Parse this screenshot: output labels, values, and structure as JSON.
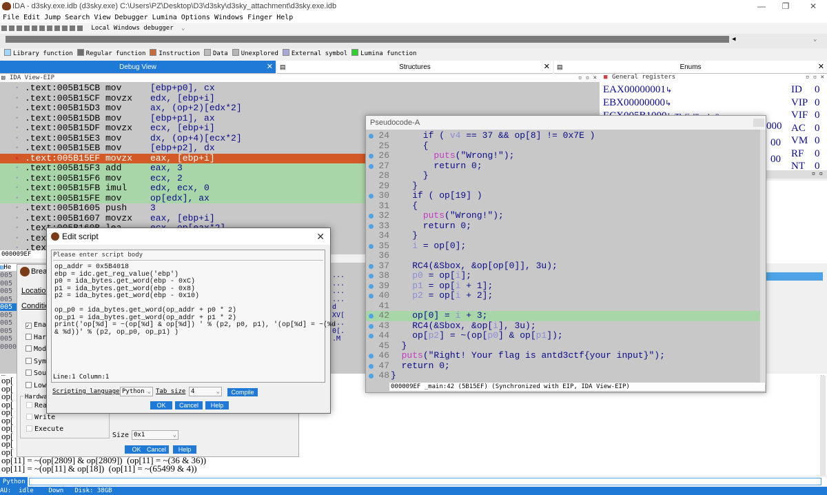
{
  "window": {
    "title": "IDA - d3sky.exe.idb (d3sky.exe) C:\\Users\\PZ\\Desktop\\D3\\d3sky\\d3sky_attachment\\d3sky.exe.idb",
    "minimize": "—",
    "maximize": "❐",
    "close": "✕"
  },
  "menu": [
    "File",
    "Edit",
    "Jump",
    "Search",
    "View",
    "Debugger",
    "Lumina",
    "Options",
    "Windows",
    "Finger",
    "Help"
  ],
  "toolbar": {
    "debugger_label": "Local Windows debugger"
  },
  "legend": [
    {
      "label": "Library function",
      "color": "#a0d8ff"
    },
    {
      "label": "Regular function",
      "color": "#6f6f6f"
    },
    {
      "label": "Instruction",
      "color": "#c56c3e"
    },
    {
      "label": "Data",
      "color": "#bcbcbc"
    },
    {
      "label": "Unexplored",
      "color": "#b5b5b5"
    },
    {
      "label": "External symbol",
      "color": "#a7a7d8"
    },
    {
      "label": "Lumina function",
      "color": "#2fcf2f"
    }
  ],
  "tabs": {
    "debug": "Debug View",
    "structures": "Structures",
    "enums": "Enums"
  },
  "ida_view": {
    "title": "IDA View-EIP",
    "status": "000009EF",
    "lines": [
      {
        "addr": ".text:005B15CB",
        "mn": "mov",
        "op": "[ebp+p0], cx",
        "hl": ""
      },
      {
        "addr": ".text:005B15CF",
        "mn": "movzx",
        "op": "edx, [ebp+i]",
        "hl": ""
      },
      {
        "addr": ".text:005B15D3",
        "mn": "mov",
        "op": "ax, (op+2)[edx*2]",
        "hl": ""
      },
      {
        "addr": ".text:005B15DB",
        "mn": "mov",
        "op": "[ebp+p1], ax",
        "hl": ""
      },
      {
        "addr": ".text:005B15DF",
        "mn": "movzx",
        "op": "ecx, [ebp+i]",
        "hl": ""
      },
      {
        "addr": ".text:005B15E3",
        "mn": "mov",
        "op": "dx, (op+4)[ecx*2]",
        "hl": ""
      },
      {
        "addr": ".text:005B15EB",
        "mn": "mov",
        "op": "[ebp+p2], dx",
        "hl": ""
      },
      {
        "addr": ".text:005B15EF",
        "mn": "movzx",
        "op": "eax, [ebp+i]",
        "hl": "bp"
      },
      {
        "addr": ".text:005B15F3",
        "mn": "add",
        "op": "eax, 3",
        "hl": "g"
      },
      {
        "addr": ".text:005B15F6",
        "mn": "mov",
        "op": "ecx, 2",
        "hl": "g"
      },
      {
        "addr": ".text:005B15FB",
        "mn": "imul",
        "op": "edx, ecx, 0",
        "hl": "g"
      },
      {
        "addr": ".text:005B15FE",
        "mn": "mov",
        "op": "op[edx], ax",
        "hl": "g"
      },
      {
        "addr": ".text:005B1605",
        "mn": "push",
        "op": "3",
        "hl": ""
      },
      {
        "addr": ".text:005B1607",
        "mn": "movzx",
        "op": "eax, [ebp+i]",
        "hl": ""
      },
      {
        "addr": ".text:005B160B",
        "mn": "lea",
        "op": "ecx, op[eax*2]",
        "hl": ""
      },
      {
        "addr": ".text",
        "mn": "",
        "op": "",
        "hl": ""
      },
      {
        "addr": ".text",
        "mn": "",
        "op": "",
        "hl": ""
      }
    ]
  },
  "registers": {
    "title": "General registers",
    "regs": [
      {
        "name": "EAX",
        "value": "00000001",
        "arrow": "↳"
      },
      {
        "name": "EBX",
        "value": "00000000",
        "arrow": "↳"
      },
      {
        "name": "ECX",
        "value": "005B1000",
        "arrow": "↳ TlsCallback_0"
      }
    ],
    "flags": [
      {
        "name": "ID",
        "value": "0"
      },
      {
        "name": "VIP",
        "value": "0"
      },
      {
        "name": "VIF",
        "value": "0"
      },
      {
        "name": "AC",
        "value": "0"
      },
      {
        "name": "VM",
        "value": "0"
      },
      {
        "name": "RF",
        "value": "0"
      },
      {
        "name": "NT",
        "value": "0"
      }
    ],
    "partial": [
      "000",
      "00",
      "00"
    ]
  },
  "pseudocode": {
    "title": "Pseudocode-A",
    "status": "000009EF _main:42 (5B15EF) (Synchronized with EIP, IDA View-EIP)",
    "lines": [
      {
        "n": "24",
        "b": true,
        "hl": false,
        "parts": [
          {
            "t": "      if ( "
          },
          {
            "t": "v4",
            "c": "var"
          },
          {
            "t": " == 37 && op[8] != 0x7E )"
          }
        ]
      },
      {
        "n": "25",
        "b": false,
        "hl": false,
        "parts": [
          {
            "t": "      {"
          }
        ]
      },
      {
        "n": "26",
        "b": true,
        "hl": false,
        "parts": [
          {
            "t": "        "
          },
          {
            "t": "puts",
            "c": "str"
          },
          {
            "t": "(\"Wrong!\");"
          }
        ]
      },
      {
        "n": "27",
        "b": true,
        "hl": false,
        "parts": [
          {
            "t": "        return 0;"
          }
        ]
      },
      {
        "n": "28",
        "b": false,
        "hl": false,
        "parts": [
          {
            "t": "      }"
          }
        ]
      },
      {
        "n": "29",
        "b": false,
        "hl": false,
        "parts": [
          {
            "t": "    }"
          }
        ]
      },
      {
        "n": "30",
        "b": true,
        "hl": false,
        "parts": [
          {
            "t": "    if ( op[19] )"
          }
        ]
      },
      {
        "n": "31",
        "b": false,
        "hl": false,
        "parts": [
          {
            "t": "    {"
          }
        ]
      },
      {
        "n": "32",
        "b": true,
        "hl": false,
        "parts": [
          {
            "t": "      "
          },
          {
            "t": "puts",
            "c": "str"
          },
          {
            "t": "(\"Wrong!\");"
          }
        ]
      },
      {
        "n": "33",
        "b": true,
        "hl": false,
        "parts": [
          {
            "t": "      return 0;"
          }
        ]
      },
      {
        "n": "34",
        "b": false,
        "hl": false,
        "parts": [
          {
            "t": "    }"
          }
        ]
      },
      {
        "n": "35",
        "b": true,
        "hl": false,
        "parts": [
          {
            "t": "    "
          },
          {
            "t": "i",
            "c": "var"
          },
          {
            "t": " = op[0];"
          }
        ]
      },
      {
        "n": "36",
        "b": false,
        "hl": false,
        "parts": [
          {
            "t": ""
          }
        ]
      },
      {
        "n": "37",
        "b": true,
        "hl": false,
        "parts": [
          {
            "t": "    RC4(&Sbox, &op[op[0]], 3u);"
          }
        ]
      },
      {
        "n": "38",
        "b": true,
        "hl": false,
        "parts": [
          {
            "t": "    "
          },
          {
            "t": "p0",
            "c": "var"
          },
          {
            "t": " = op["
          },
          {
            "t": "i",
            "c": "var"
          },
          {
            "t": "];"
          }
        ]
      },
      {
        "n": "39",
        "b": true,
        "hl": false,
        "parts": [
          {
            "t": "    "
          },
          {
            "t": "p1",
            "c": "var"
          },
          {
            "t": " = op["
          },
          {
            "t": "i",
            "c": "var"
          },
          {
            "t": " + 1];"
          }
        ]
      },
      {
        "n": "40",
        "b": true,
        "hl": false,
        "parts": [
          {
            "t": "    "
          },
          {
            "t": "p2",
            "c": "var"
          },
          {
            "t": " = op["
          },
          {
            "t": "i",
            "c": "var"
          },
          {
            "t": " + 2];"
          }
        ]
      },
      {
        "n": "41",
        "b": false,
        "hl": false,
        "parts": [
          {
            "t": ""
          }
        ]
      },
      {
        "n": "42",
        "b": true,
        "hl": true,
        "parts": [
          {
            "t": "    op[0] = "
          },
          {
            "t": "i",
            "c": "var"
          },
          {
            "t": " + 3;"
          }
        ]
      },
      {
        "n": "43",
        "b": true,
        "hl": false,
        "parts": [
          {
            "t": "    RC4(&Sbox, &op["
          },
          {
            "t": "i",
            "c": "var"
          },
          {
            "t": "], 3u);"
          }
        ]
      },
      {
        "n": "44",
        "b": true,
        "hl": false,
        "parts": [
          {
            "t": "    op["
          },
          {
            "t": "p2",
            "c": "var"
          },
          {
            "t": "] = ~(op["
          },
          {
            "t": "p0",
            "c": "var"
          },
          {
            "t": "] & op["
          },
          {
            "t": "p1",
            "c": "var"
          },
          {
            "t": "]);"
          }
        ]
      },
      {
        "n": "45",
        "b": false,
        "hl": false,
        "parts": [
          {
            "t": "  }"
          }
        ]
      },
      {
        "n": "46",
        "b": true,
        "hl": false,
        "parts": [
          {
            "t": "  "
          },
          {
            "t": "puts",
            "c": "str"
          },
          {
            "t": "(\"Right! Your flag is antd3ctf{your input}\");"
          }
        ]
      },
      {
        "n": "47",
        "b": true,
        "hl": false,
        "parts": [
          {
            "t": "  return 0;"
          }
        ]
      },
      {
        "n": "48",
        "b": true,
        "hl": false,
        "parts": [
          {
            "t": "}"
          }
        ]
      }
    ]
  },
  "breakpoint_dialog": {
    "title": "Break",
    "location_label": "Location",
    "condition_label": "Condition",
    "checks": [
      "Enab",
      "Hard",
      "Modu",
      "Symb",
      "Sour",
      "Low"
    ],
    "hardware_label": "Hardwa",
    "hw_checks": [
      "Read",
      "Write",
      "Execute"
    ],
    "size_label": "Size",
    "size_value": "0x1",
    "ok": "OK",
    "cancel": "Cancel",
    "help": "Help"
  },
  "edit_script": {
    "title": "Edit script",
    "prompt": "Please enter script body",
    "script": "op_addr = 0x5B4018\nebp = idc.get_reg_value('ebp')\np0 = ida_bytes.get_word(ebp - 0xC)\np1 = ida_bytes.get_word(ebp - 0x8)\np2 = ida_bytes.get_word(ebp - 0x10)\n\nop_p0 = ida_bytes.get_word(op_addr + p0 * 2)\nop_p1 = ida_bytes.get_word(op_addr + p1 * 2)\nprint('op[%d] = ~(op[%d] & op[%d]) ' % (p2, p0, p1), '(op[%d] = ~(%d\n& %d))' % (p2, op_p0, op_p1) )",
    "cursor": "Line:1  Column:1",
    "lang_label": "Scripting language",
    "lang_value": "Python",
    "tab_label": "Tab size",
    "tab_value": "4",
    "compile": "Compile",
    "ok": "OK",
    "cancel": "Cancel",
    "help": "Help"
  },
  "left_stubs": {
    "hex_prefix": "He",
    "addr_rows": [
      "005",
      "005",
      "005",
      "005",
      "005",
      "005",
      "005",
      "005",
      "005",
      "0000"
    ],
    "op_rows": [
      "op[",
      "op[",
      "op[",
      "op[",
      "op[",
      "op[",
      "op[",
      "op[",
      "op[",
      "op["
    ]
  },
  "hex_fragments": [
    "...",
    "...",
    "...",
    "...",
    "d",
    "XV[",
    "...",
    "0[.",
    ".M"
  ],
  "output": {
    "lines": [
      "op[11] = ~(op[2809] & op[2809])  (op[11] = ~(36 & 36))",
      "op[11] = ~(op[11] & op[18])  (op[11] = ~(65499 & 4))"
    ]
  },
  "python_tab": "Python",
  "statusbar": "AU:  idle    Down   Disk: 38GB"
}
